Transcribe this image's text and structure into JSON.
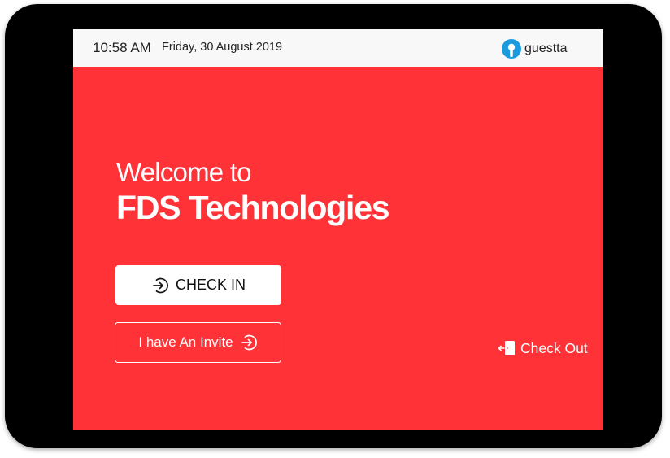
{
  "status_bar": {
    "time": "10:58 AM",
    "date": "Friday, 30 August 2019",
    "brand_name": "guestta"
  },
  "welcome": {
    "line1": "Welcome to",
    "company": "FDS Technologies"
  },
  "actions": {
    "check_in_label": "CHECK IN",
    "invite_label": "I have An Invite",
    "check_out_label": "Check Out"
  },
  "icons": {
    "brand": "guestta-logo-icon",
    "check_in": "arrow-in-circle-icon",
    "invite": "arrow-in-circle-icon",
    "check_out": "door-exit-icon"
  },
  "colors": {
    "accent": "#ff3337",
    "topbar": "#f8f8f8",
    "brand_blue": "#1a9be0",
    "device_frame": "#000000"
  }
}
